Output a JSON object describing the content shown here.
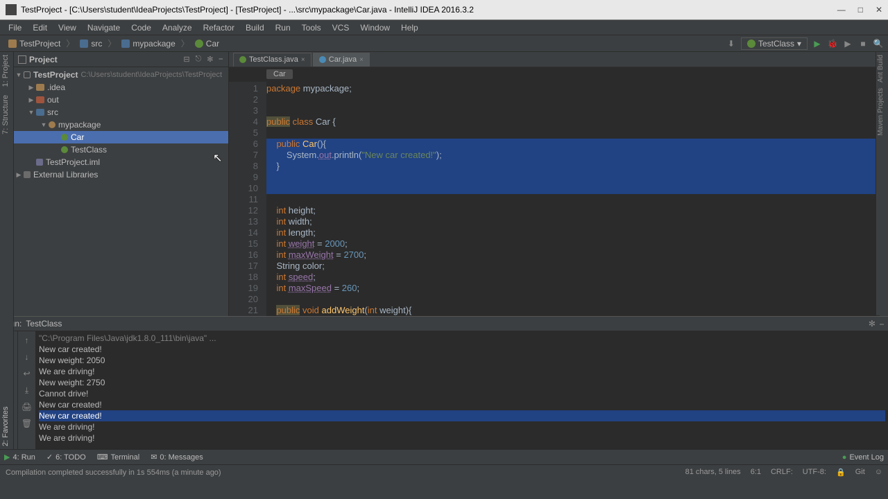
{
  "window": {
    "title": "TestProject - [C:\\Users\\student\\IdeaProjects\\TestProject] - [TestProject] - ...\\src\\mypackage\\Car.java - IntelliJ IDEA 2016.3.2"
  },
  "menubar": [
    "File",
    "Edit",
    "View",
    "Navigate",
    "Code",
    "Analyze",
    "Refactor",
    "Build",
    "Run",
    "Tools",
    "VCS",
    "Window",
    "Help"
  ],
  "breadcrumb": {
    "items": [
      {
        "label": "TestProject",
        "icon": "folder"
      },
      {
        "label": "src",
        "icon": "folder-blue"
      },
      {
        "label": "mypackage",
        "icon": "folder-blue"
      },
      {
        "label": "Car",
        "icon": "class"
      }
    ]
  },
  "run_config": "TestClass",
  "project_panel_title": "Project",
  "tree": {
    "root": "TestProject",
    "root_path": "C:\\Users\\student\\IdeaProjects\\TestProject",
    "idea": ".idea",
    "out": "out",
    "src": "src",
    "pkg": "mypackage",
    "car": "Car",
    "testclass": "TestClass",
    "iml": "TestProject.iml",
    "ext": "External Libraries"
  },
  "editor_tabs": [
    {
      "label": "TestClass.java",
      "active": false
    },
    {
      "label": "Car.java",
      "active": true
    }
  ],
  "editor_breadcrumb": "Car",
  "code": {
    "lines": [
      {
        "n": 1,
        "html": "<span class='kw'>package</span> mypackage;"
      },
      {
        "n": 2,
        "html": ""
      },
      {
        "n": 3,
        "html": ""
      },
      {
        "n": 4,
        "html": "<span class='kw warn-bg'>public</span> <span class='kw'>class</span> Car {"
      },
      {
        "n": 5,
        "html": ""
      },
      {
        "n": 6,
        "html": "    <span class='kw'>public</span> <span class='mth'>Car</span>(){",
        "sel": true
      },
      {
        "n": 7,
        "html": "        System.<span class='fld'>out</span>.println(<span class='str'>\"New car created!\"</span>);",
        "sel": true
      },
      {
        "n": 8,
        "html": "    }",
        "sel": true
      },
      {
        "n": 9,
        "html": "",
        "sel": true
      },
      {
        "n": 10,
        "html": "    ",
        "sel": true
      },
      {
        "n": 11,
        "html": ""
      },
      {
        "n": 12,
        "html": "    <span class='kw'>int</span> height;"
      },
      {
        "n": 13,
        "html": "    <span class='kw'>int</span> width;"
      },
      {
        "n": 14,
        "html": "    <span class='kw'>int</span> length;"
      },
      {
        "n": 15,
        "html": "    <span class='kw'>int</span> <span class='fld'>weight</span> = <span class='num'>2000</span>;"
      },
      {
        "n": 16,
        "html": "    <span class='kw'>int</span> <span class='fld'>maxWeight</span> = <span class='num'>2700</span>;"
      },
      {
        "n": 17,
        "html": "    String color;"
      },
      {
        "n": 18,
        "html": "    <span class='kw'>int</span> <span class='fld'>speed</span>;"
      },
      {
        "n": 19,
        "html": "    <span class='kw'>int</span> <span class='fld'>maxSpeed</span> = <span class='num'>260</span>;"
      },
      {
        "n": 20,
        "html": ""
      },
      {
        "n": 21,
        "html": "    <span class='kw warn-bg'>public</span> <span class='kw'>void</span> <span class='mth'>addWeight</span>(<span class='kw'>int</span> weight){"
      }
    ]
  },
  "run": {
    "label": "Run:",
    "config": "TestClass",
    "output": [
      {
        "text": "\"C:\\Program Files\\Java\\jdk1.8.0_111\\bin\\java\" ...",
        "cls": "cmd"
      },
      {
        "text": "New car created!"
      },
      {
        "text": "New weight: 2050"
      },
      {
        "text": "We are driving!"
      },
      {
        "text": "New weight: 2750"
      },
      {
        "text": "Cannot drive!"
      },
      {
        "text": "New car created!"
      },
      {
        "text": "New car created!",
        "cls": "sel"
      },
      {
        "text": "We are driving!"
      },
      {
        "text": "We are driving!"
      }
    ]
  },
  "bottom_tabs": {
    "run": "4: Run",
    "todo": "6: TODO",
    "terminal": "Terminal",
    "messages": "0: Messages",
    "eventlog": "Event Log"
  },
  "statusbar": {
    "msg": "Compilation completed successfully in 1s 554ms (a minute ago)",
    "chars": "81 chars, 5 lines",
    "pos": "6:1",
    "crlf": "CRLF:",
    "enc": "UTF-8:",
    "git": "Git"
  },
  "left_tabs": [
    "1: Project",
    "7: Structure"
  ],
  "left_tabs_bottom": [
    "2: Favorites"
  ],
  "right_tabs": [
    "Ant Build",
    "Maven Projects"
  ]
}
